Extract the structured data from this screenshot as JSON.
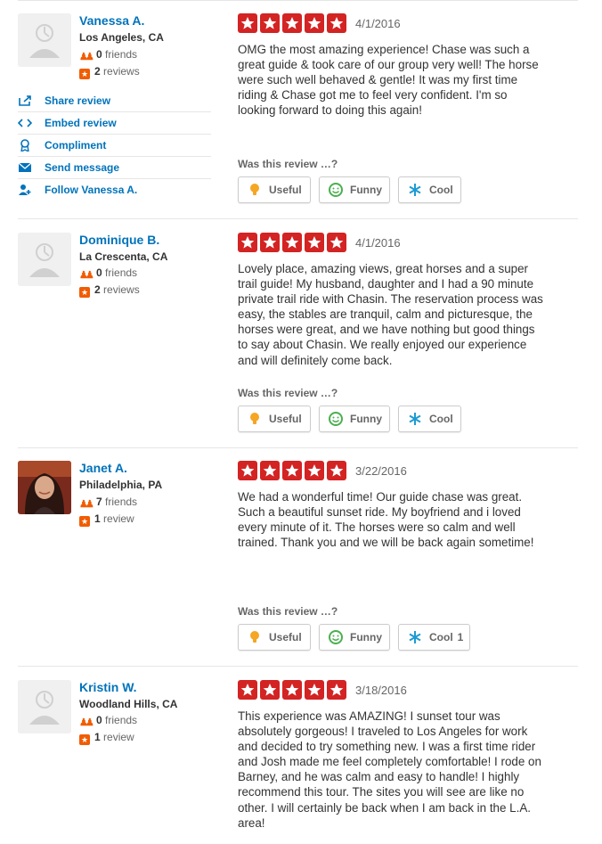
{
  "helpful_prompt": "Was this review …?",
  "vote_labels": {
    "useful": "Useful",
    "funny": "Funny",
    "cool": "Cool"
  },
  "actions": {
    "share": "Share review",
    "embed": "Embed review",
    "compliment": "Compliment",
    "message": "Send message",
    "follow": "Follow Vanessa A."
  },
  "reviews": [
    {
      "name": "Vanessa A.",
      "location": "Los Angeles, CA",
      "friends_count": "0",
      "friends_label": "friends",
      "reviews_count": "2",
      "reviews_label": "reviews",
      "rating": 5,
      "date": "4/1/2016",
      "lines": [
        "OMG the most amazing experience! Chase was such a",
        "great guide & took care of our group very well! The horse",
        "were such well behaved & gentle! It was my first time",
        "riding & Chase got me to feel very confident. I'm so",
        "looking forward to doing this again!"
      ],
      "cool_count": ""
    },
    {
      "name": "Dominique B.",
      "location": "La Crescenta, CA",
      "friends_count": "0",
      "friends_label": "friends",
      "reviews_count": "2",
      "reviews_label": "reviews",
      "rating": 5,
      "date": "4/1/2016",
      "lines": [
        "Lovely place, amazing views, great horses and a super",
        "trail guide! My husband, daughter and I had a 90 minute",
        "private trail ride with Chasin. The reservation process was",
        "easy, the stables are tranquil, calm and picturesque, the",
        "horses were great, and we have nothing but good things",
        "to say about Chasin. We really enjoyed our experience",
        "and will definitely come back."
      ],
      "cool_count": ""
    },
    {
      "name": "Janet A.",
      "location": "Philadelphia, PA",
      "friends_count": "7",
      "friends_label": "friends",
      "reviews_count": "1",
      "reviews_label": "review",
      "rating": 5,
      "date": "3/22/2016",
      "lines": [
        "We had a wonderful time! Our guide chase was great.",
        "Such a beautiful sunset ride. My boyfriend and i loved",
        "every minute of it. The horses were so calm and well",
        "trained. Thank you and we will be back again sometime!"
      ],
      "cool_count": "1"
    },
    {
      "name": "Kristin W.",
      "location": "Woodland Hills, CA",
      "friends_count": "0",
      "friends_label": "friends",
      "reviews_count": "1",
      "reviews_label": "review",
      "rating": 5,
      "date": "3/18/2016",
      "lines": [
        "This experience was AMAZING! I sunset tour was",
        "absolutely gorgeous! I traveled to Los Angeles for work",
        "and decided to try something new. I was a first time rider",
        "and Josh made me feel completely comfortable! I rode on",
        "Barney, and he was calm and easy to handle! I highly",
        "recommend this tour. The sites you will see are like no",
        "other. I will certainly be back when I am back in the L.A.",
        "area!"
      ],
      "cool_count": ""
    }
  ],
  "colors": {
    "star": "#d32323",
    "link": "#0073bb",
    "stat_icon": "#f15c00",
    "divider": "#e6e6e6"
  }
}
